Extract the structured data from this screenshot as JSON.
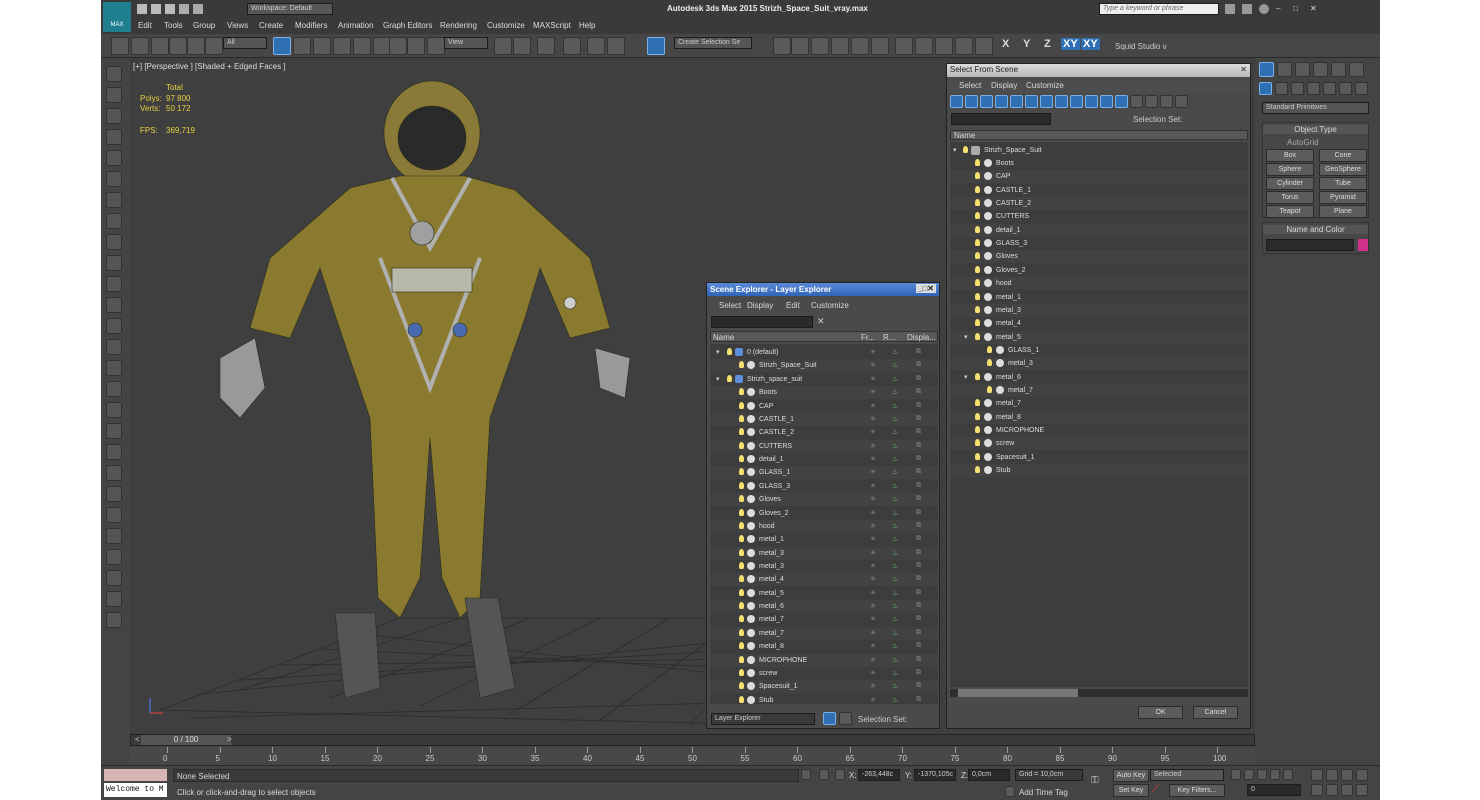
{
  "app": {
    "title": "Autodesk 3ds Max 2015  Strizh_Space_Suit_vray.max",
    "logo": "MAX",
    "workspace": "Workspace: Default",
    "search_placeholder": "Type a keyword or phrase"
  },
  "menu": [
    "Edit",
    "Tools",
    "Group",
    "Views",
    "Create",
    "Modifiers",
    "Animation",
    "Graph Editors",
    "Rendering",
    "Customize",
    "MAXScript",
    "Help"
  ],
  "toolbar": {
    "filter": "All",
    "view": "View",
    "selection_set": "Create Selection Se",
    "axes": [
      "X",
      "Y",
      "Z",
      "XY",
      "XY"
    ],
    "studio": "Squid Studio v"
  },
  "viewport": {
    "label": "[+] [Perspective ] [Shaded + Edged Faces ]",
    "stats": {
      "total": "Total",
      "polys_label": "Polys:",
      "polys": "97 800",
      "verts_label": "Verts:",
      "verts": "50 172",
      "fps_label": "FPS:",
      "fps": "369,719"
    }
  },
  "scene_explorer": {
    "title": "Scene Explorer - Layer Explorer",
    "menu": [
      "Select",
      "Display",
      "Edit",
      "Customize"
    ],
    "columns": [
      "Name",
      "Fr...",
      "R...",
      "Displa..."
    ],
    "layers": [
      {
        "name": "0 (default)",
        "indent": 0,
        "type": "layer"
      },
      {
        "name": "Strizh_Space_Suit",
        "indent": 1,
        "type": "object"
      },
      {
        "name": "Strizh_space_suit",
        "indent": 0,
        "type": "layer"
      }
    ],
    "items": [
      "Boots",
      "CAP",
      "CASTLE_1",
      "CASTLE_2",
      "CUTTERS",
      "detail_1",
      "GLASS_1",
      "GLASS_3",
      "Gloves",
      "Gloves_2",
      "hood",
      "metal_1",
      "metal_3",
      "metal_3",
      "metal_4",
      "metal_5",
      "metal_6",
      "metal_7",
      "metal_7",
      "metal_8",
      "MICROPHONE",
      "screw",
      "Spacesuit_1",
      "Stub"
    ],
    "footer": {
      "explorer": "Layer Explorer",
      "selection_set": "Selection Set:"
    }
  },
  "select_from_scene": {
    "title": "Select From Scene",
    "menu": [
      "Select",
      "Display",
      "Customize"
    ],
    "selection_set": "Selection Set:",
    "column": "Name",
    "root": "Strizh_Space_Suit",
    "items": [
      {
        "name": "Boots",
        "level": 1
      },
      {
        "name": "CAP",
        "level": 1
      },
      {
        "name": "CASTLE_1",
        "level": 1
      },
      {
        "name": "CASTLE_2",
        "level": 1
      },
      {
        "name": "CUTTERS",
        "level": 1
      },
      {
        "name": "detail_1",
        "level": 1
      },
      {
        "name": "GLASS_3",
        "level": 1
      },
      {
        "name": "Gloves",
        "level": 1
      },
      {
        "name": "Gloves_2",
        "level": 1
      },
      {
        "name": "hood",
        "level": 1
      },
      {
        "name": "metal_1",
        "level": 1
      },
      {
        "name": "metal_3",
        "level": 1
      },
      {
        "name": "metal_4",
        "level": 1
      },
      {
        "name": "metal_5",
        "level": 1
      },
      {
        "name": "GLASS_1",
        "level": 2
      },
      {
        "name": "metal_3",
        "level": 2
      },
      {
        "name": "metal_6",
        "level": 1
      },
      {
        "name": "metal_7",
        "level": 2
      },
      {
        "name": "metal_7",
        "level": 1
      },
      {
        "name": "metal_8",
        "level": 1
      },
      {
        "name": "MICROPHONE",
        "level": 1
      },
      {
        "name": "screw",
        "level": 1
      },
      {
        "name": "Spacesuit_1",
        "level": 1
      },
      {
        "name": "Stub",
        "level": 1
      }
    ],
    "ok": "OK",
    "cancel": "Cancel"
  },
  "command_panel": {
    "dropdown": "Standard Primitives",
    "object_type": "Object Type",
    "autogrid": "AutoGrid",
    "buttons": [
      "Box",
      "Cone",
      "Sphere",
      "GeoSphere",
      "Cylinder",
      "Tube",
      "Torus",
      "Pyramid",
      "Teapot",
      "Plane"
    ],
    "name_color": "Name and Color",
    "object_color": "#d0308a"
  },
  "timeline": {
    "frame": "0 / 100",
    "ticks": [
      "0",
      "5",
      "10",
      "15",
      "20",
      "25",
      "30",
      "35",
      "40",
      "45",
      "50",
      "55",
      "60",
      "65",
      "70",
      "75",
      "80",
      "85",
      "90",
      "95",
      "100"
    ]
  },
  "status": {
    "listener": "Welcome to M",
    "selected": "None Selected",
    "prompt": "Click or click-and-drag to select objects",
    "x_label": "X:",
    "x": "-263,448c",
    "y_label": "Y:",
    "y": "-1370,105c",
    "z_label": "Z:",
    "z": "0,0cm",
    "grid": "Grid = 10,0cm",
    "add_time_tag": "Add Time Tag",
    "auto_key": "Auto Key",
    "set_key": "Set Key",
    "key_mode": "Selected",
    "key_filters": "Key Filters...",
    "frame_field": "0"
  }
}
